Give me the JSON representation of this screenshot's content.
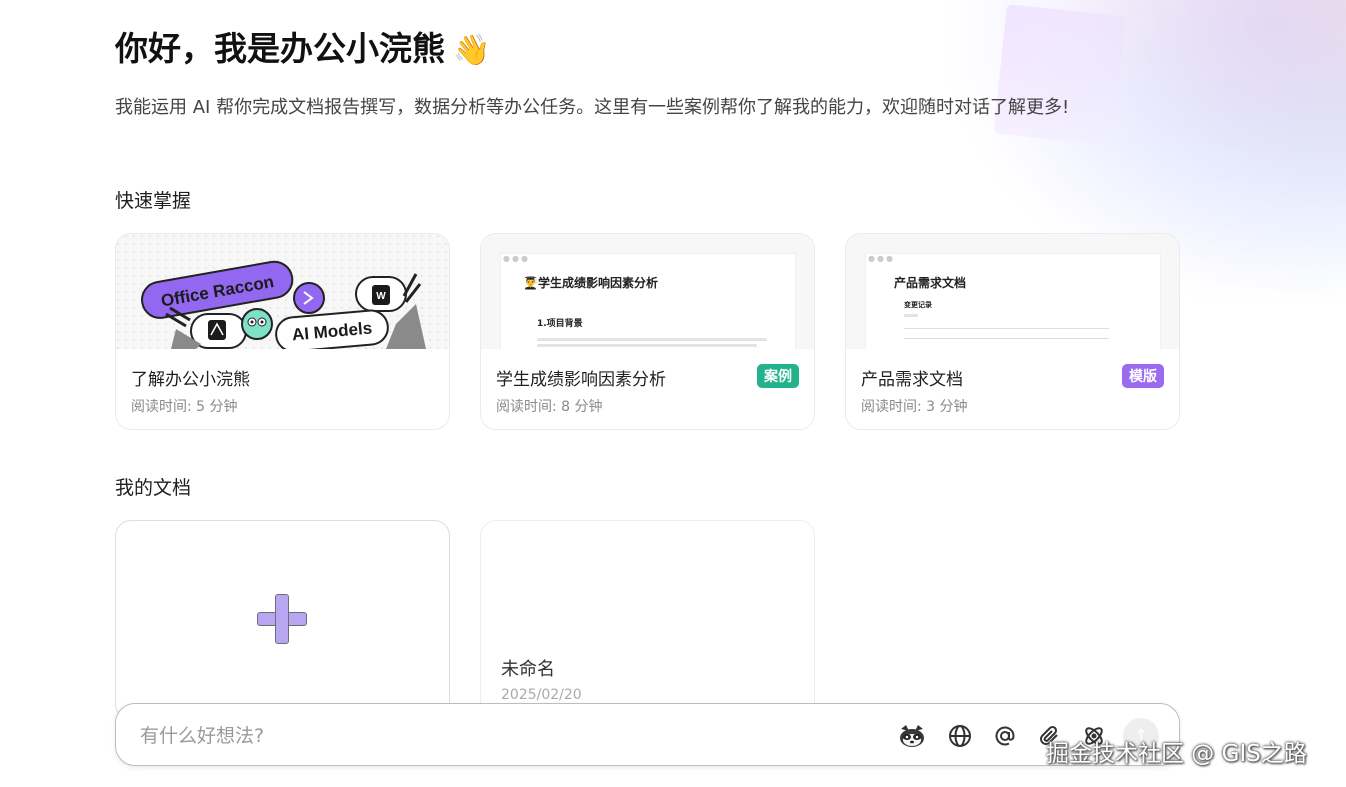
{
  "header": {
    "greeting": "你好，我是办公小浣熊",
    "wave_emoji": "👋",
    "intro": "我能运用 AI 帮你完成文档报告撰写，数据分析等办公任务。这里有一些案例帮你了解我的能力，欢迎随时对话了解更多!"
  },
  "quick_start": {
    "title": "快速掌握",
    "cards": [
      {
        "title": "了解办公小浣熊",
        "meta": "阅读时间: 5 分钟",
        "badge": "",
        "thumb_text_1": "Office Raccon",
        "thumb_text_2": "AI Models"
      },
      {
        "title": "学生成绩影响因素分析",
        "meta": "阅读时间: 8 分钟",
        "badge": "案例",
        "thumb_title": "👨‍🎓学生成绩影响因素分析",
        "thumb_section": "1.项目背景"
      },
      {
        "title": "产品需求文档",
        "meta": "阅读时间: 3 分钟",
        "badge": "模版",
        "thumb_title": "产品需求文档",
        "thumb_section": "变更记录"
      }
    ]
  },
  "my_docs": {
    "title": "我的文档",
    "items": [
      {
        "name": "未命名",
        "date": "2025/02/20"
      }
    ]
  },
  "chat": {
    "placeholder": "有什么好想法?"
  },
  "icons": {
    "raccoon": "raccoon-icon",
    "globe": "globe-icon",
    "at": "at-icon",
    "attach": "paperclip-icon",
    "atom": "atom-icon",
    "send": "send-arrow-icon"
  },
  "colors": {
    "case_badge": "#23b38c",
    "template_badge": "#9a6bee",
    "plus_accent": "#b8a6f1"
  },
  "watermark": "掘金技术社区 @ GIS之路"
}
